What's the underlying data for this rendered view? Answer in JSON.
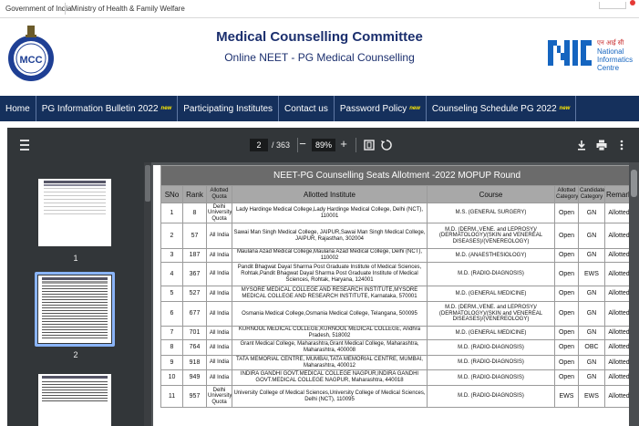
{
  "gov_bar": {
    "links": [
      "Government of India",
      "Ministry of Health & Family Welfare"
    ]
  },
  "header": {
    "title": "Medical Counselling Committee",
    "subtitle": "Online NEET - PG Medical Counselling",
    "left_logo_text": "MCC",
    "right_logo": {
      "hindi": "एन आई सी",
      "line1": "National",
      "line2": "Informatics",
      "line3": "Centre"
    }
  },
  "nav": {
    "items": [
      {
        "label": "Home",
        "new": false
      },
      {
        "label": "PG Information Bulletin 2022",
        "new": true
      },
      {
        "label": "Participating Institutes",
        "new": false
      },
      {
        "label": "Contact us",
        "new": false
      },
      {
        "label": "Password Policy",
        "new": true
      },
      {
        "label": "Counseling Schedule PG 2022",
        "new": true
      }
    ],
    "new_badge": "new"
  },
  "viewer": {
    "current_page": "2",
    "total_pages": "/ 363",
    "zoom": "89%",
    "minus": "−",
    "plus": "+",
    "thumbnails": [
      {
        "label": "1"
      },
      {
        "label": "2"
      },
      {
        "label": ""
      }
    ],
    "selected_thumbnail": 2
  },
  "table": {
    "caption": "NEET-PG  Counselling Seats Allotment -2022 MOPUP Round",
    "headers": [
      "SNo",
      "Rank",
      "Allotted Quota",
      "Allotted Institute",
      "Course",
      "Allotted Category",
      "Candidate Category",
      "Remarks"
    ],
    "rows": [
      [
        "1",
        "8",
        "Delhi University Quota",
        "Lady Hardinge Medical College,Lady Hardinge Medical College, Delhi (NCT), 110001",
        "M.S. (GENERAL SURGERY)",
        "Open",
        "GN",
        "Allotted"
      ],
      [
        "2",
        "57",
        "All India",
        "Sawai Man Singh Medical College, JAIPUR,Sawai Man Singh Medical College, JAIPUR, Rajasthan, 302004",
        "M.D. (DERM.,VENE. and LEPROSY)/ (DERMATOLOGY)/(SKIN and VENEREAL DISEASES)/(VENEREOLOGY)",
        "Open",
        "GN",
        "Allotted"
      ],
      [
        "3",
        "187",
        "All India",
        "Maulana Azad Medical College,Maulana Azad Medical College, Delhi (NCT), 110002",
        "M.D. (ANAESTHESIOLOGY)",
        "Open",
        "GN",
        "Allotted"
      ],
      [
        "4",
        "367",
        "All India",
        "Pandit Bhagwat Dayal Sharma Post Graduate Institute of Medical Sciences, Rohtak,Pandit Bhagwat Dayal Sharma Post Graduate Institute of Medical Sciences, Rohtak, Haryana, 124001",
        "M.D. (RADIO-DIAGNOSIS)",
        "Open",
        "EWS",
        "Allotted"
      ],
      [
        "5",
        "527",
        "All India",
        "MYSORE MEDICAL COLLEGE AND RESEARCH INSTITUTE,MYSORE MEDICAL COLLEGE AND RESEARCH INSTITUTE, Karnataka, 570001",
        "M.D. (GENERAL MEDICINE)",
        "Open",
        "GN",
        "Allotted"
      ],
      [
        "6",
        "677",
        "All India",
        "Osmania Medical College,Osmania Medical College, Telangana, 500095",
        "M.D. (DERM.,VENE. and LEPROSY)/ (DERMATOLOGY)/(SKIN and VENEREAL DISEASES)/(VENEREOLOGY)",
        "Open",
        "GN",
        "Allotted"
      ],
      [
        "7",
        "701",
        "All India",
        "KURNOOL MEDICAL COLLEGE,KURNOOL MEDICAL COLLEGE, Andhra Pradesh, 518002",
        "M.D. (GENERAL MEDICINE)",
        "Open",
        "GN",
        "Allotted"
      ],
      [
        "8",
        "764",
        "All India",
        "Grant Medical College, Maharashtra,Grant Medical College, Maharashtra, Maharashtra, 400008",
        "M.D. (RADIO-DIAGNOSIS)",
        "Open",
        "OBC",
        "Allotted"
      ],
      [
        "9",
        "918",
        "All India",
        "TATA MEMORIAL CENTRE, MUMBAI,TATA MEMORIAL CENTRE, MUMBAI, Maharashtra, 400012",
        "M.D. (RADIO-DIAGNOSIS)",
        "Open",
        "GN",
        "Allotted"
      ],
      [
        "10",
        "949",
        "All India",
        "INDIRA GANDHI GOVT.MEDICAL COLLEGE NAGPUR,INDIRA GANDHI GOVT.MEDICAL COLLEGE NAGPUR, Maharashtra, 440018",
        "M.D. (RADIO-DIAGNOSIS)",
        "Open",
        "GN",
        "Allotted"
      ],
      [
        "11",
        "957",
        "Delhi University Quota",
        "University College of Medical Sciences,University College of Medical Sciences, Delhi (NCT), 110095",
        "M.D. (RADIO-DIAGNOSIS)",
        "EWS",
        "EWS",
        "Allotted"
      ]
    ]
  },
  "colors": {
    "nav_bg": "#15305c",
    "title": "#1b2f6e",
    "viewer_toolbar": "#323639",
    "viewer_bg": "#525659",
    "table_caption": "#6b6b6b",
    "table_header": "#a8a8a8",
    "new_badge": "#ffea00"
  }
}
